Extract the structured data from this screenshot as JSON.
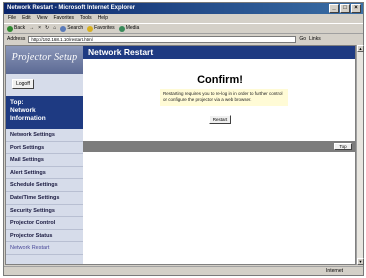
{
  "window": {
    "title": "Network Restart - Microsoft Internet Explorer",
    "controls": [
      "_",
      "□",
      "×"
    ]
  },
  "menubar": [
    "File",
    "Edit",
    "View",
    "Favorites",
    "Tools",
    "Help"
  ],
  "toolbar": {
    "back": "Back",
    "forward": "→",
    "stop": "×",
    "refresh": "↻",
    "home": "⌂",
    "search": "Search",
    "favorites": "Favorites",
    "media": "Media"
  },
  "addressbar": {
    "label": "Address",
    "url": "http://192.168.1.10/restart.html",
    "go": "Go",
    "links": "Links"
  },
  "sidebar": {
    "logo": "Projector Setup",
    "logoff": "Logoff",
    "top_nav": "Top:\nNetwork\nInformation",
    "items": [
      "Network Settings",
      "Port Settings",
      "Mail Settings",
      "Alert Settings",
      "Schedule Settings",
      "Date/Time Settings",
      "Security Settings",
      "Projector Control",
      "Projector Status",
      "Network Restart"
    ]
  },
  "main": {
    "header": "Network Restart",
    "confirm_title": "Confirm!",
    "message": "Restarting requires you to re-log in in order to further control or configure the projector via a web browser.",
    "restart_button": "Restart",
    "top_button": "Top"
  },
  "statusbar": {
    "text": "",
    "zone": "Internet"
  }
}
